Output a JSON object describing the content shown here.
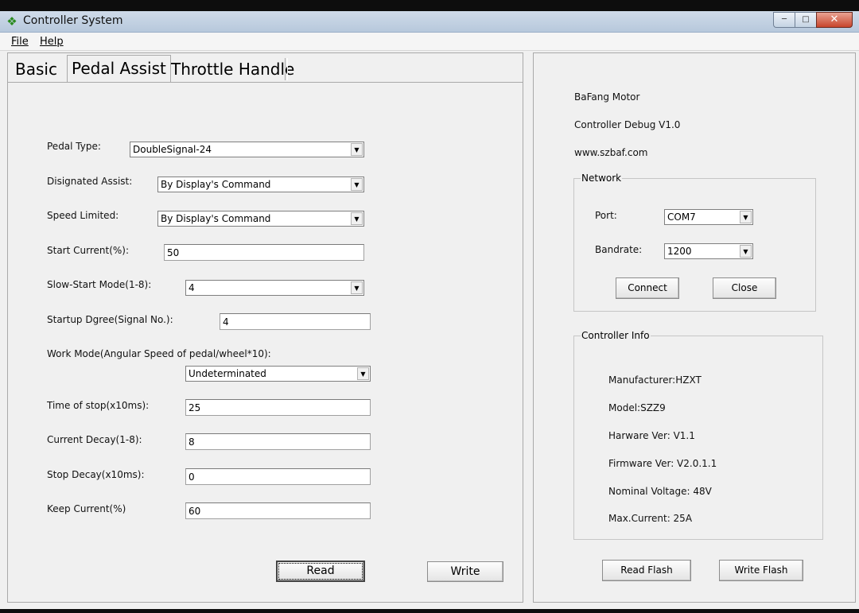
{
  "window": {
    "title": "Controller System",
    "icon": "bafang-app-icon",
    "controls": {
      "minimize": "minimize-icon",
      "maximize": "maximize-icon",
      "close": "close-icon"
    }
  },
  "menu": {
    "file": "File",
    "help": "Help"
  },
  "tabs": [
    {
      "label": "Basic"
    },
    {
      "label": "Pedal Assist",
      "active": true
    },
    {
      "label": "Throttle Handle"
    }
  ],
  "pedal_assist": {
    "pedal_type": {
      "label": "Pedal Type:",
      "value": "DoubleSignal-24"
    },
    "designated_assist": {
      "label": "Disignated Assist:",
      "value": "By Display's Command"
    },
    "speed_limited": {
      "label": "Speed Limited:",
      "value": "By Display's Command"
    },
    "start_current": {
      "label": "Start Current(%):",
      "value": "50"
    },
    "slow_start_mode": {
      "label": "Slow-Start Mode(1-8):",
      "value": "4"
    },
    "startup_degree": {
      "label": "Startup Dgree(Signal No.):",
      "value": "4"
    },
    "work_mode": {
      "label": "Work Mode(Angular Speed of pedal/wheel*10):",
      "value": "Undeterminated"
    },
    "time_of_stop": {
      "label": "Time of stop(x10ms):",
      "value": "25"
    },
    "current_decay": {
      "label": "Current Decay(1-8):",
      "value": "8"
    },
    "stop_decay": {
      "label": "Stop Decay(x10ms):",
      "value": "0"
    },
    "keep_current": {
      "label": "Keep Current(%)",
      "value": "60"
    },
    "read_label": "Read",
    "write_label": "Write"
  },
  "info": {
    "line1": "BaFang Motor",
    "line2": "Controller Debug V1.0",
    "line3": "www.szbaf.com"
  },
  "network": {
    "title": "Network",
    "port": {
      "label": "Port:",
      "value": "COM7"
    },
    "baudrate": {
      "label": "Bandrate:",
      "value": "1200"
    },
    "connect_label": "Connect",
    "close_label": "Close"
  },
  "controller_info": {
    "title": "Controller Info",
    "manufacturer": "Manufacturer:HZXT",
    "model": "Model:SZZ9",
    "hardware": "Harware Ver: V1.1",
    "firmware": "Firmware Ver: V2.0.1.1",
    "voltage": "Nominal Voltage: 48V",
    "max_current": "Max.Current: 25A"
  },
  "flash": {
    "read_label": "Read Flash",
    "write_label": "Write Flash"
  }
}
